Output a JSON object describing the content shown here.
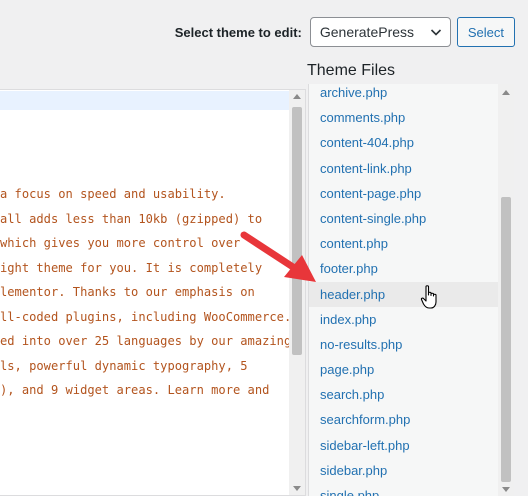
{
  "theme_selector": {
    "label": "Select theme to edit:",
    "selected_theme": "GeneratePress",
    "select_button": "Select"
  },
  "editor": {
    "lines": [
      "a focus on speed and usability.",
      "all adds less than 10kb (gzipped) to",
      " which gives you more control over",
      "ight theme for you. It is completely",
      "lementor. Thanks to our emphasis on",
      "ll-coded plugins, including WooCommerce.",
      "ed into over 25 languages by our amazing",
      "ls, powerful dynamic typography, 5",
      "), and 9 widget areas. Learn more and"
    ]
  },
  "theme_files": {
    "heading": "Theme Files",
    "files": [
      "archive.php",
      "comments.php",
      "content-404.php",
      "content-link.php",
      "content-page.php",
      "content-single.php",
      "content.php",
      "footer.php",
      "header.php",
      "index.php",
      "no-results.php",
      "page.php",
      "search.php",
      "searchform.php",
      "sidebar-left.php",
      "sidebar.php",
      "single.php"
    ],
    "hovered_file": "header.php"
  },
  "colors": {
    "link": "#2271b1",
    "code_text": "#b3541e",
    "annotation_arrow": "#e8363a"
  }
}
